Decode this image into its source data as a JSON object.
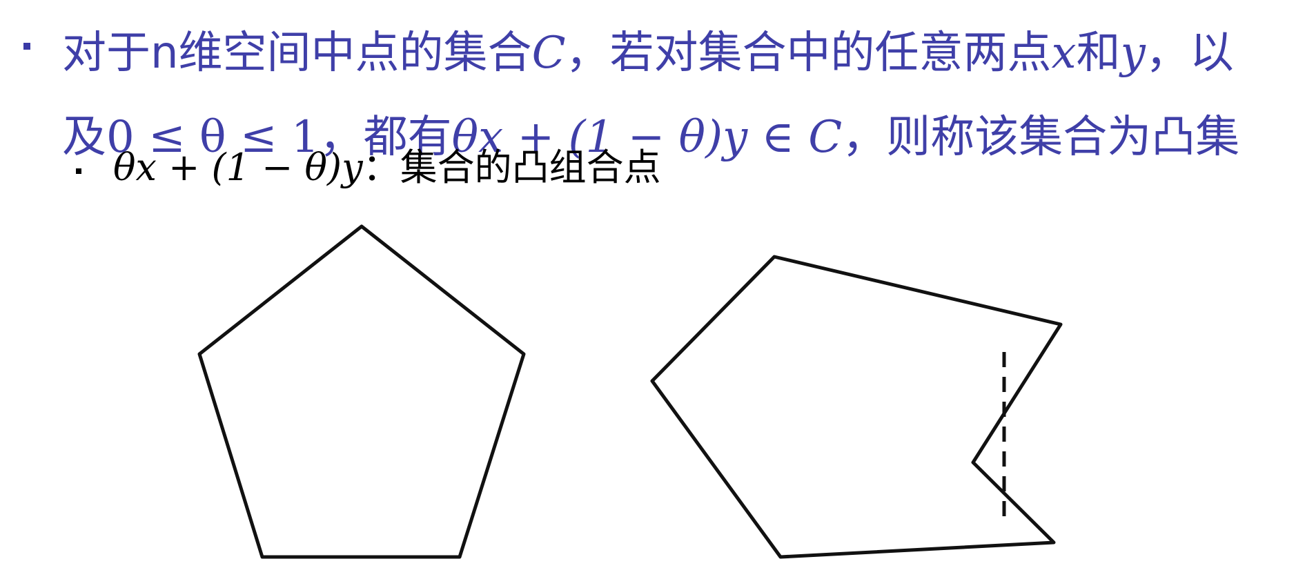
{
  "main_point": {
    "line1": {
      "prefix": "对于n维空间中点的集合",
      "set_symbol": "C",
      "middle": "，若对集合中的任意两点",
      "x_symbol": "x",
      "and_word": "和",
      "y_symbol": "y",
      "suffix": "，以"
    },
    "line2": {
      "prefix": "及",
      "condition": "0 ≤ θ ≤ 1",
      "middle": "，都有",
      "expression": "θx + (1 − θ)y ∈ C",
      "suffix": "，则称该集合为凸集"
    }
  },
  "sub_point": {
    "expression": "θx + (1 − θ)y",
    "text": "：集合的凸组合点"
  },
  "colors": {
    "main_text": "#3f3fa8",
    "sub_text": "#000000",
    "shape_stroke": "#111111"
  }
}
